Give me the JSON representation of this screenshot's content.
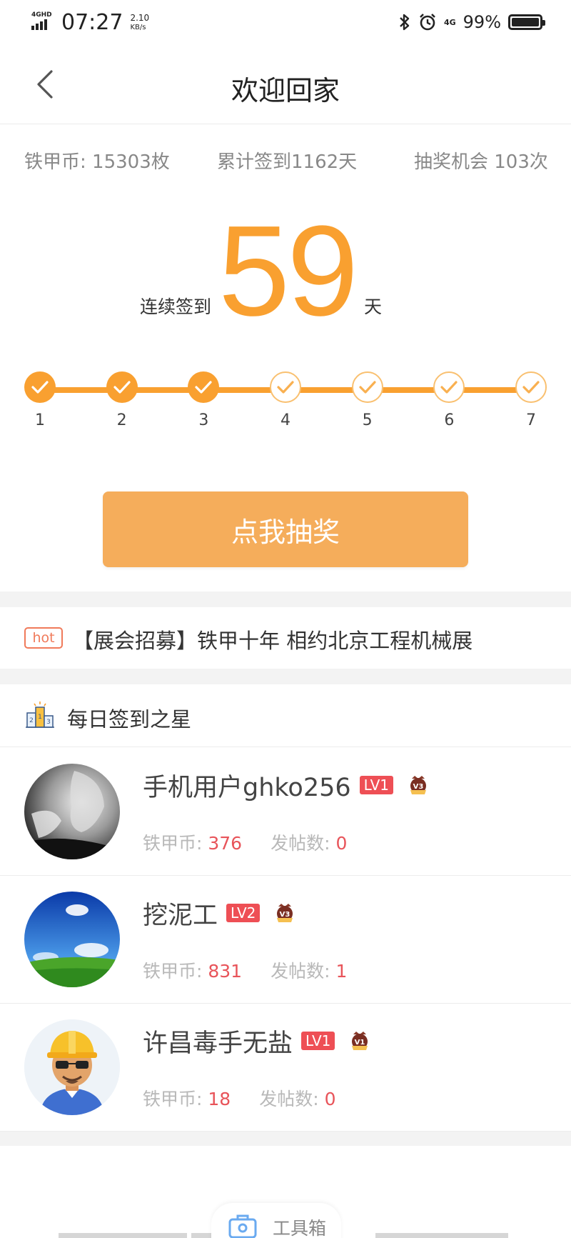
{
  "status_bar": {
    "network_label": "4GHD",
    "time": "07:27",
    "speed_value": "2.10",
    "speed_unit": "KB/s",
    "network_right": "4G",
    "battery": "99%"
  },
  "nav": {
    "title": "欢迎回家"
  },
  "stats": {
    "coins": "铁甲币: 15303枚",
    "total_checkin": "累计签到1162天",
    "lottery_chances": "抽奖机会 103次"
  },
  "streak": {
    "prefix": "连续签到",
    "days": "59",
    "suffix": "天"
  },
  "progress": {
    "days": [
      "1",
      "2",
      "3",
      "4",
      "5",
      "6",
      "7"
    ],
    "completed_count": 3
  },
  "draw_button": "点我抽奖",
  "hot_news": {
    "badge": "hot",
    "text": "【展会招募】铁甲十年 相约北京工程机械展"
  },
  "section": {
    "title": "每日签到之星"
  },
  "users": [
    {
      "name": "手机用户ghko256",
      "level": "LV1",
      "vip": "V3",
      "coins_label": "铁甲币: ",
      "coins": "376",
      "posts_label": "发帖数: ",
      "posts": "0"
    },
    {
      "name": "挖泥工",
      "level": "LV2",
      "vip": "V3",
      "coins_label": "铁甲币: ",
      "coins": "831",
      "posts_label": "发帖数: ",
      "posts": "1"
    },
    {
      "name": "许昌毒手无盐",
      "level": "LV1",
      "vip": "V1",
      "coins_label": "铁甲币: ",
      "coins": "18",
      "posts_label": "发帖数: ",
      "posts": "0"
    }
  ],
  "bottom": {
    "toolbox_label": "工具箱"
  },
  "colors": {
    "accent": "#f9a030",
    "button": "#f5ad5b",
    "level_badge": "#ee4f55",
    "value_red": "#e8545a",
    "hot": "#f07a5a"
  }
}
